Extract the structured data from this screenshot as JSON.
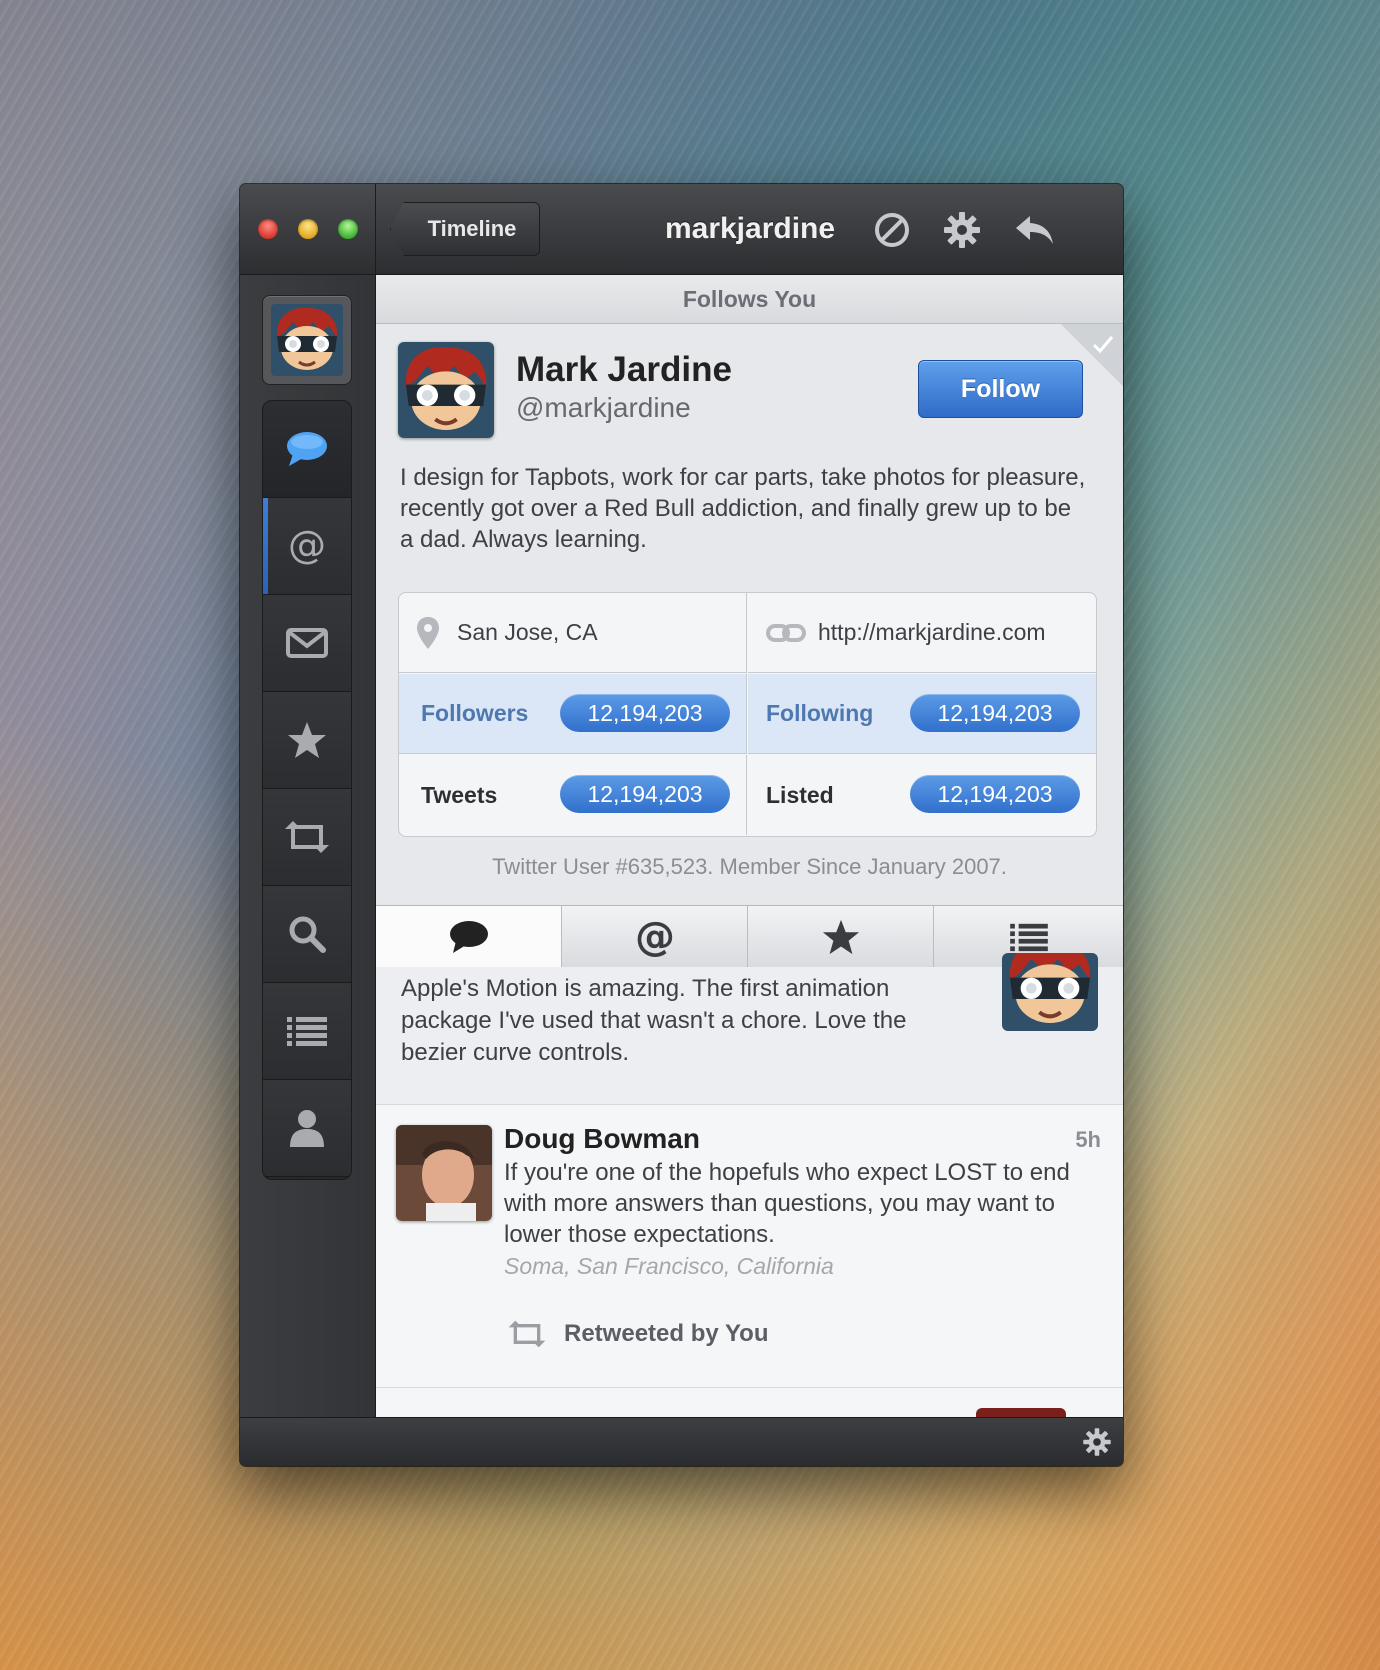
{
  "window": {
    "back_label": "Timeline",
    "title": "markjardine",
    "toolbar_icons": [
      "block-icon",
      "gear-icon",
      "reply-icon"
    ]
  },
  "sidebar": {
    "items": [
      {
        "icon": "speech-bubble-icon",
        "selected": true
      },
      {
        "icon": "at-sign-icon",
        "unread_indicator": true
      },
      {
        "icon": "envelope-icon"
      },
      {
        "icon": "star-icon"
      },
      {
        "icon": "retweet-icon"
      },
      {
        "icon": "search-icon"
      },
      {
        "icon": "list-icon"
      },
      {
        "icon": "person-icon"
      }
    ]
  },
  "profile": {
    "banner": "Follows You",
    "name": "Mark Jardine",
    "handle": "@markjardine",
    "follow_label": "Follow",
    "bio": "I design for Tapbots, work for car parts, take photos for pleasure, recently got over a Red Bull addiction, and finally grew up to be a dad. Always learning.",
    "location": "San Jose, CA",
    "url": "http://markjardine.com",
    "stats": {
      "followers_label": "Followers",
      "followers": "12,194,203",
      "following_label": "Following",
      "following": "12,194,203",
      "tweets_label": "Tweets",
      "tweets": "12,194,203",
      "listed_label": "Listed",
      "listed": "12,194,203"
    },
    "member_since": "Twitter User #635,523. Member Since January 2007."
  },
  "tabs": [
    {
      "icon": "speech-bubble-icon",
      "active": true
    },
    {
      "icon": "at-sign-icon"
    },
    {
      "icon": "star-icon"
    },
    {
      "icon": "list-icon"
    }
  ],
  "tweets": [
    {
      "text": "Apple's Motion is amazing. The first animation package I've used that wasn't a chore. Love the bezier curve controls."
    },
    {
      "name": "Doug Bowman",
      "time": "5h",
      "text": "If you're one of the hopefuls who expect LOST to end with more answers than questions, you may want to lower those expectations.",
      "location": "Soma, San Francisco, California",
      "retweet_label": "Retweeted by You"
    }
  ],
  "colors": {
    "accent": "#3170cc",
    "highlight_row": "#dbe7f6",
    "titlebar": "#2d2e31"
  }
}
